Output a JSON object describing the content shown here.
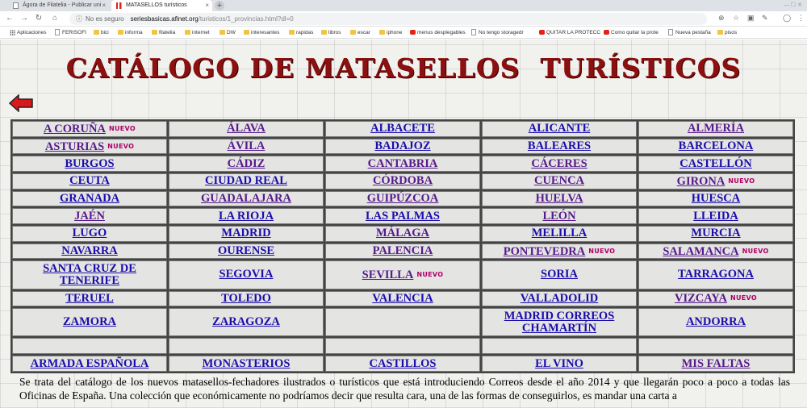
{
  "browser": {
    "tabs": [
      {
        "title": "Ágora de Filatelia - Publicar uni"
      },
      {
        "title": "MATASELLOS turísticos"
      }
    ],
    "new_tab": "+",
    "address": {
      "security": "No es seguro",
      "host": "seriesbasicas.afinet.org",
      "path": "/turisticos/1_provincias.html?dl=0"
    },
    "bookmarks": [
      {
        "label": "Aplicaciones",
        "icon": "apps-grid-icon"
      },
      {
        "label": "FERISOFI",
        "icon": "page-icon"
      },
      {
        "label": "bici",
        "icon": "folder-icon"
      },
      {
        "label": "informa",
        "icon": "folder-icon"
      },
      {
        "label": "filatelia",
        "icon": "folder-icon"
      },
      {
        "label": "internet",
        "icon": "folder-icon"
      },
      {
        "label": "DW",
        "icon": "folder-icon"
      },
      {
        "label": "interesantes",
        "icon": "folder-icon"
      },
      {
        "label": "rapidas",
        "icon": "folder-icon"
      },
      {
        "label": "libros",
        "icon": "folder-icon"
      },
      {
        "label": "escar",
        "icon": "folder-icon"
      },
      {
        "label": "iphone",
        "icon": "folder-icon"
      },
      {
        "label": "menus desplegables",
        "icon": "youtube-icon"
      },
      {
        "label": "No tengo storagedr",
        "icon": "avatar-icon"
      },
      {
        "label": "QUITAR LA PROTECC",
        "icon": "youtube-icon"
      },
      {
        "label": "Como quitar la prote",
        "icon": "youtube-icon"
      },
      {
        "label": "Nueva pestaña",
        "icon": "star-icon"
      },
      {
        "label": "pisos",
        "icon": "folder-icon"
      }
    ]
  },
  "page": {
    "title": "CATÁLOGO DE MATASELLOS  TURÍSTICOS",
    "badge": "NUEVO",
    "colors": {
      "title": "#8c1010",
      "link": "#1a0dab",
      "visited": "#551a8b",
      "badge": "#b0006a"
    },
    "rows": [
      [
        {
          "label": "A CORUÑA",
          "nuevo": true,
          "visited": true
        },
        {
          "label": "ÁLAVA",
          "visited": true
        },
        {
          "label": "ALBACETE"
        },
        {
          "label": "ALICANTE"
        },
        {
          "label": "ALMERÍA",
          "visited": true
        }
      ],
      [
        {
          "label": "ASTURIAS",
          "nuevo": true,
          "visited": true
        },
        {
          "label": "ÁVILA",
          "visited": true
        },
        {
          "label": "BADAJOZ"
        },
        {
          "label": "BALEARES"
        },
        {
          "label": "BARCELONA"
        }
      ],
      [
        {
          "label": "BURGOS"
        },
        {
          "label": "CÁDIZ",
          "visited": true
        },
        {
          "label": "CANTABRIA",
          "visited": true
        },
        {
          "label": "CÁCERES",
          "visited": true
        },
        {
          "label": "CASTELLÓN"
        }
      ],
      [
        {
          "label": "CEUTA"
        },
        {
          "label": "CIUDAD REAL"
        },
        {
          "label": "CÓRDOBA",
          "visited": true
        },
        {
          "label": "CUENCA",
          "visited": true
        },
        {
          "label": "GIRONA",
          "nuevo": true,
          "visited": true
        }
      ],
      [
        {
          "label": "GRANADA"
        },
        {
          "label": "GUADALAJARA",
          "visited": true
        },
        {
          "label": "GUIPÚZCOA",
          "visited": true
        },
        {
          "label": "HUELVA",
          "visited": true
        },
        {
          "label": "HUESCA"
        }
      ],
      [
        {
          "label": "JAÉN",
          "visited": true
        },
        {
          "label": "LA RIOJA"
        },
        {
          "label": "LAS PALMAS"
        },
        {
          "label": "LEÓN",
          "visited": true
        },
        {
          "label": "LLEIDA"
        }
      ],
      [
        {
          "label": "LUGO"
        },
        {
          "label": "MADRID"
        },
        {
          "label": "MÁLAGA",
          "visited": true
        },
        {
          "label": "MELILLA"
        },
        {
          "label": "MURCIA"
        }
      ],
      [
        {
          "label": "NAVARRA"
        },
        {
          "label": "OURENSE"
        },
        {
          "label": "PALENCIA",
          "visited": true
        },
        {
          "label": "PONTEVEDRA",
          "nuevo": true,
          "visited": true
        },
        {
          "label": "SALAMANCA",
          "nuevo": true,
          "visited": true
        }
      ],
      [
        {
          "label": "SANTA CRUZ DE TENERIFE",
          "tall": true
        },
        {
          "label": "SEGOVIA"
        },
        {
          "label": "SEVILLA",
          "nuevo": true,
          "visited": true
        },
        {
          "label": "SORIA"
        },
        {
          "label": "TARRAGONA"
        }
      ],
      [
        {
          "label": "TERUEL"
        },
        {
          "label": "TOLEDO"
        },
        {
          "label": "VALENCIA"
        },
        {
          "label": "VALLADOLID"
        },
        {
          "label": "VIZCAYA",
          "nuevo": true,
          "visited": true
        }
      ],
      [
        {
          "label": "ZAMORA",
          "tall": true
        },
        {
          "label": "ZARAGOZA"
        },
        {
          "label": ""
        },
        {
          "label": "MADRID CORREOS CHAMARTÍN"
        },
        {
          "label": "ANDORRA"
        }
      ],
      [
        {
          "label": ""
        },
        {
          "label": ""
        },
        {
          "label": ""
        },
        {
          "label": ""
        },
        {
          "label": ""
        }
      ],
      [
        {
          "label": "ARMADA ESPAÑOLA"
        },
        {
          "label": "MONASTERIOS"
        },
        {
          "label": "CASTILLOS"
        },
        {
          "label": "EL VINO"
        },
        {
          "label": "MIS FALTAS",
          "visited": true
        }
      ]
    ],
    "intro": "Se trata del catálogo de los nuevos matasellos-fechadores ilustrados o turísticos que está introduciendo Correos desde el año 2014 y que llegarán poco a poco a todas las Oficinas de España. Una colección que económicamente no podríamos decir que resulta cara, una de las formas de conseguirlos, es mandar una carta a"
  }
}
